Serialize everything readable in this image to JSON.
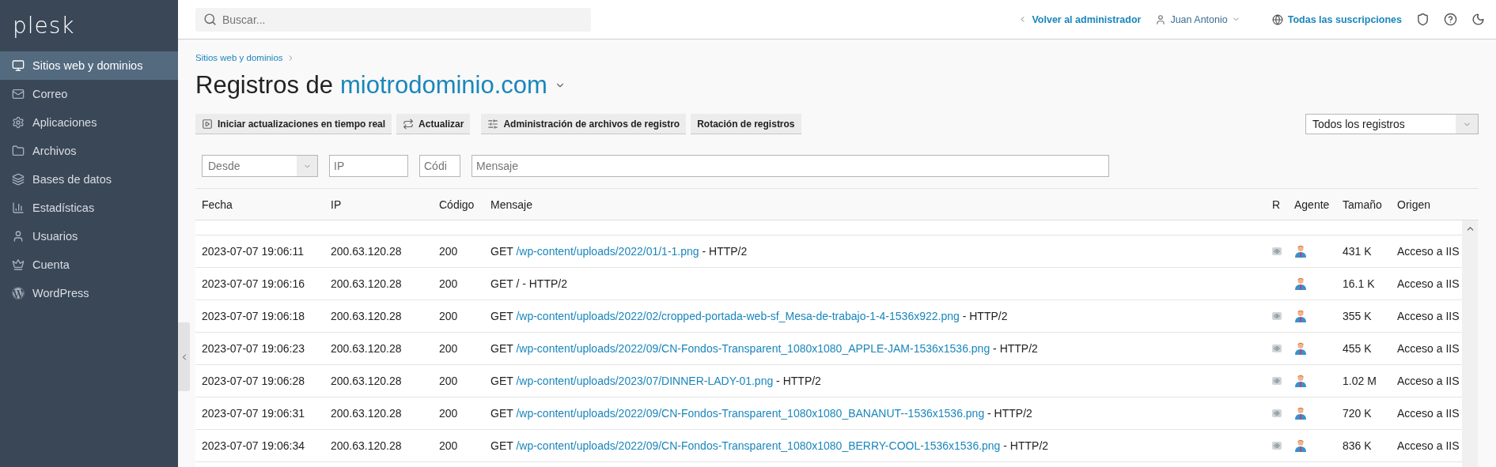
{
  "sidebar": {
    "logo": "plesk",
    "items": [
      {
        "label": "Sitios web y dominios",
        "selected": true
      },
      {
        "label": "Correo",
        "selected": false
      },
      {
        "label": "Aplicaciones",
        "selected": false
      },
      {
        "label": "Archivos",
        "selected": false
      },
      {
        "label": "Bases de datos",
        "selected": false
      },
      {
        "label": "Estadísticas",
        "selected": false
      },
      {
        "label": "Usuarios",
        "selected": false
      },
      {
        "label": "Cuenta",
        "selected": false
      },
      {
        "label": "WordPress",
        "selected": false
      }
    ]
  },
  "topbar": {
    "search": {
      "placeholder": "Buscar..."
    },
    "back_link": "Volver al administrador",
    "user": "Juan Antonio",
    "subscriptions": "Todas las suscripciones"
  },
  "breadcrumb": [
    "Sitios web y dominios"
  ],
  "title": {
    "prefix": "Registros de",
    "domain": "miotrodominio.com"
  },
  "toolbar": {
    "buttons": [
      {
        "label": "Iniciar actualizaciones en tiempo real"
      },
      {
        "label": "Actualizar"
      },
      {
        "label": "Administración de archivos de registro"
      },
      {
        "label": "Rotación de registros"
      }
    ],
    "log_select": "Todos los registros"
  },
  "filters": {
    "from": {
      "placeholder": "Desde"
    },
    "ip": {
      "placeholder": "IP"
    },
    "code": {
      "placeholder": "Códi"
    },
    "message": {
      "placeholder": "Mensaje"
    }
  },
  "table": {
    "columns": [
      "Fecha",
      "IP",
      "Código",
      "Mensaje",
      "R",
      "Agente",
      "Tamaño",
      "Origen"
    ],
    "rows": [
      {
        "date": "2023-07-07 19:06:11",
        "ip": "200.63.120.28",
        "code": "200",
        "message": [
          {
            "text": "GET",
            "link": false
          },
          {
            "text": "/wp-content/uploads/2022/01/1-1.png",
            "link": true
          },
          {
            "text": "- HTTP/2",
            "link": false
          }
        ],
        "referrer": true,
        "size": "431 K",
        "origin": "Acceso a IIS"
      },
      {
        "date": "2023-07-07 19:06:16",
        "ip": "200.63.120.28",
        "code": "200",
        "message": [
          {
            "text": "GET / - HTTP/2",
            "link": false
          }
        ],
        "referrer": false,
        "size": "16.1 K",
        "origin": "Acceso a IIS"
      },
      {
        "date": "2023-07-07 19:06:18",
        "ip": "200.63.120.28",
        "code": "200",
        "message": [
          {
            "text": "GET",
            "link": false
          },
          {
            "text": "/wp-content/uploads/2022/02/cropped-portada-web-sf_Mesa-de-trabajo-1-4-1536x922.png",
            "link": true
          },
          {
            "text": "- HTTP/2",
            "link": false
          }
        ],
        "referrer": true,
        "size": "355 K",
        "origin": "Acceso a IIS"
      },
      {
        "date": "2023-07-07 19:06:23",
        "ip": "200.63.120.28",
        "code": "200",
        "message": [
          {
            "text": "GET",
            "link": false
          },
          {
            "text": "/wp-content/uploads/2022/09/CN-Fondos-Transparent_1080x1080_APPLE-JAM-1536x1536.png",
            "link": true
          },
          {
            "text": "- HTTP/2",
            "link": false
          }
        ],
        "referrer": true,
        "size": "455 K",
        "origin": "Acceso a IIS"
      },
      {
        "date": "2023-07-07 19:06:28",
        "ip": "200.63.120.28",
        "code": "200",
        "message": [
          {
            "text": "GET",
            "link": false
          },
          {
            "text": "/wp-content/uploads/2023/07/DINNER-LADY-01.png",
            "link": true
          },
          {
            "text": "- HTTP/2",
            "link": false
          }
        ],
        "referrer": true,
        "size": "1.02 M",
        "origin": "Acceso a IIS"
      },
      {
        "date": "2023-07-07 19:06:31",
        "ip": "200.63.120.28",
        "code": "200",
        "message": [
          {
            "text": "GET",
            "link": false
          },
          {
            "text": "/wp-content/uploads/2022/09/CN-Fondos-Transparent_1080x1080_BANANUT--1536x1536.png",
            "link": true
          },
          {
            "text": "- HTTP/2",
            "link": false
          }
        ],
        "referrer": true,
        "size": "720 K",
        "origin": "Acceso a IIS"
      },
      {
        "date": "2023-07-07 19:06:34",
        "ip": "200.63.120.28",
        "code": "200",
        "message": [
          {
            "text": "GET",
            "link": false
          },
          {
            "text": "/wp-content/uploads/2022/09/CN-Fondos-Transparent_1080x1080_BERRY-COOL-1536x1536.png",
            "link": true
          },
          {
            "text": "- HTTP/2",
            "link": false
          }
        ],
        "referrer": true,
        "size": "836 K",
        "origin": "Acceso a IIS"
      }
    ]
  }
}
